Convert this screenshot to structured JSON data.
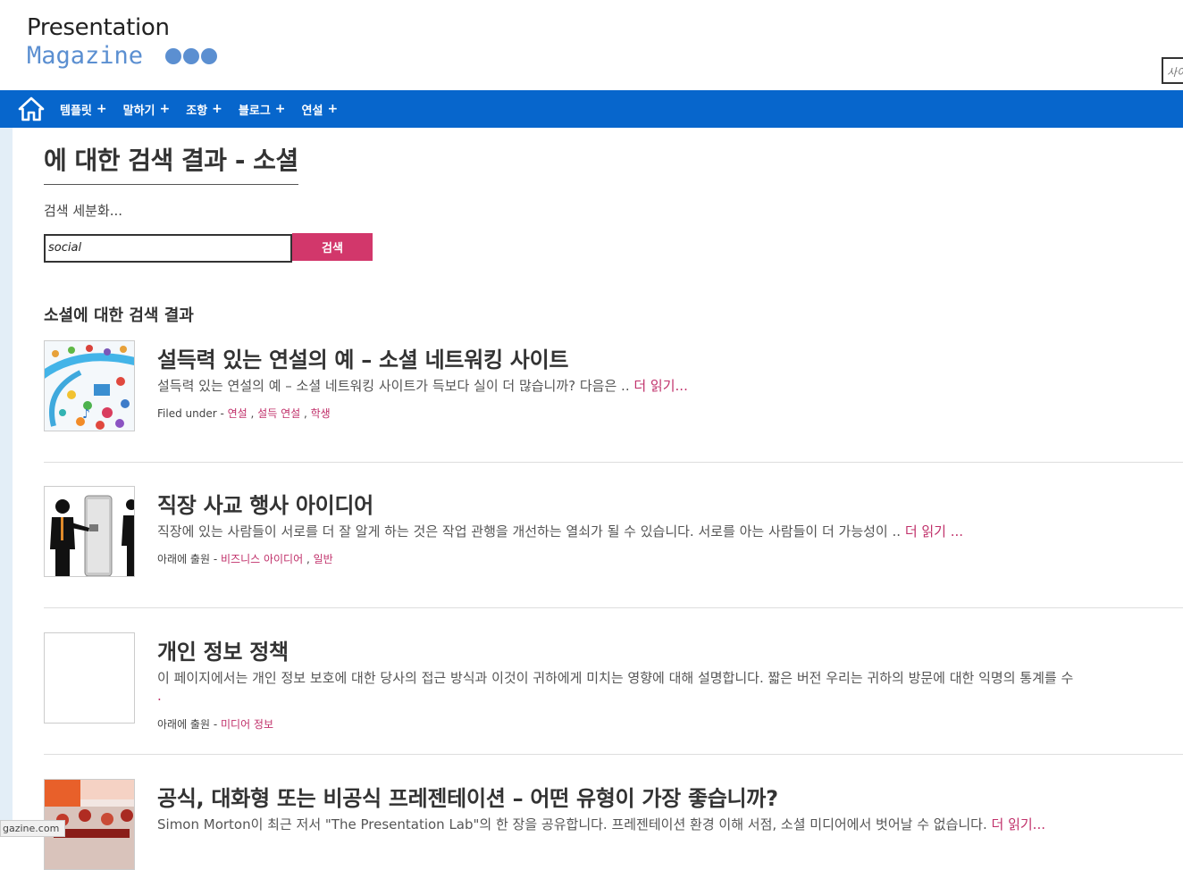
{
  "header": {
    "logo_line1": "Presentation",
    "logo_line2": "Magazine",
    "search_placeholder": "사이",
    "logo_color": "#5b8fd1"
  },
  "nav": {
    "home_icon": "home-icon",
    "items": [
      {
        "label": "템플릿",
        "plus": "+"
      },
      {
        "label": "말하기",
        "plus": "+"
      },
      {
        "label": "조항",
        "plus": "+"
      },
      {
        "label": "블로그",
        "plus": "+"
      },
      {
        "label": "연설",
        "plus": "+"
      }
    ],
    "background": "#0766cc"
  },
  "main": {
    "page_title": "에 대한 검색 결과 - 소셜",
    "refine_label": "검색 세분화...",
    "search_value": "social",
    "search_button": "검색",
    "results_heading": "소셜에 대한 검색 결과",
    "accent_color": "#d2376b"
  },
  "results": [
    {
      "title": "설득력 있는 연설의 예 – 소셜 네트워킹 사이트",
      "excerpt": "설득력 있는 연설의 예 – 소셜 네트워킹 사이트가 득보다 실이 더 많습니까? 다음은 .. ",
      "read_more": "더 읽기...",
      "meta_label": "Filed under - ",
      "tags": [
        "연설",
        "설득 연설",
        "학생"
      ],
      "thumbnail": "social-media-icons-image"
    },
    {
      "title": "직장 사교 행사 아이디어",
      "excerpt": "직장에 있는 사람들이 서로를 더 잘 알게 하는 것은 작업 관행을 개선하는 열쇠가 될 수 있습니다. 서로를 아는 사람들이 더 가능성이 .. ",
      "read_more": "더 읽기 ...",
      "meta_label": "아래에 출원 - ",
      "tags": [
        "비즈니스 아이디어",
        "일반"
      ],
      "thumbnail": "water-cooler-silhouette-image"
    },
    {
      "title": "개인 정보 정책",
      "excerpt": "이 페이지에서는 개인 정보 보호에 대한 당사의 접근 방식과 이것이 귀하에게 미치는 영향에 대해 설명합니다. 짧은 버전 우리는 귀하의 방문에 대한 익명의 통계를 수",
      "excerpt_cont": ".",
      "read_more": "",
      "meta_label": "아래에 출원 - ",
      "tags": [
        "미디어 정보"
      ],
      "thumbnail": "blank-image"
    },
    {
      "title": "공식, 대화형 또는 비공식 프레젠테이션 – 어떤 유형이 가장 좋습니까?",
      "excerpt": "Simon Morton이 최근 저서 \"The Presentation Lab\"의 한 장을 공유합니다. 프레젠테이션 환경 이해 서점, 소셜 미디어에서 벗어날 수 없습니다. ",
      "read_more": "더 읽기...",
      "thumbnail": "conference-room-image"
    }
  ],
  "status_bar": {
    "url_fragment": "gazine.com"
  }
}
